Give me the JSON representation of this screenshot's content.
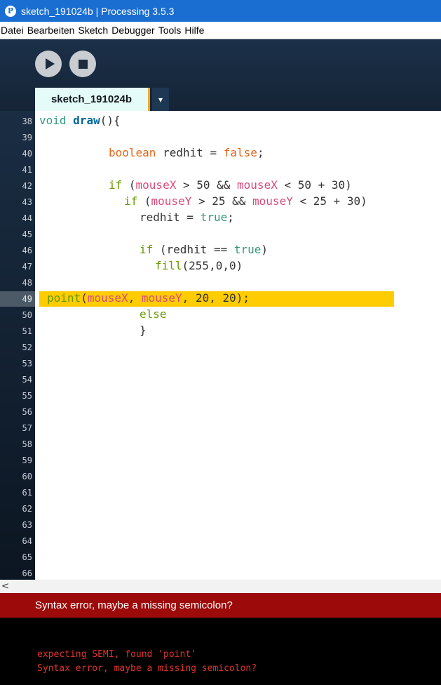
{
  "window": {
    "title": "sketch_191024b | Processing 3.5.3",
    "app_icon_glyph": "P"
  },
  "menu": [
    "Datei",
    "Bearbeiten",
    "Sketch",
    "Debugger",
    "Tools",
    "Hilfe"
  ],
  "toolbar": {
    "run_icon": "play-icon",
    "stop_icon": "stop-icon"
  },
  "tab": {
    "name": "sketch_191024b",
    "menu_glyph": "▾"
  },
  "line_numbers": [
    "38",
    "39",
    "40",
    "41",
    "42",
    "43",
    "44",
    "45",
    "46",
    "47",
    "48",
    "49",
    "50",
    "51",
    "52",
    "53",
    "54",
    "55",
    "56",
    "57",
    "58",
    "59",
    "60",
    "61",
    "62",
    "63",
    "64",
    "65",
    "66"
  ],
  "current_line": "49",
  "code": {
    "l38": {
      "kw": "void",
      "fn": "draw",
      "rest": "(){"
    },
    "l40": {
      "type": "boolean",
      "rest_a": " redhit = ",
      "type_b": "false",
      "rest_b": ";"
    },
    "l42": {
      "kw": "if",
      "a": " (",
      "v1": "mouseX",
      "b": " > 50 && ",
      "v2": "mouseX",
      "c": " < 50 + 30)"
    },
    "l43": {
      "kw": "if",
      "a": " (",
      "v1": "mouseY",
      "b": " > 25 && ",
      "v2": "mouseY",
      "c": " < 25 + 30)"
    },
    "l44": {
      "a": "redhit = ",
      "kw": "true",
      "b": ";"
    },
    "l46": {
      "kw": "if",
      "a": " (redhit == ",
      "kw2": "true",
      "b": ")"
    },
    "l47": {
      "fn": "fill",
      "a": "(255,0,0)"
    },
    "l49": {
      "fn": "point",
      "a": "(",
      "v1": "mouseX",
      "b": ", ",
      "v2": "mouseY",
      "c": ", 20, 20);"
    },
    "l50": {
      "kw": "else"
    },
    "l51": {
      "a": "}"
    }
  },
  "scroll": {
    "left_arrow": "<"
  },
  "status": {
    "message": "Syntax error, maybe a missing semicolon?"
  },
  "console": {
    "line1": "expecting SEMI, found 'point'",
    "line2": "Syntax error, maybe a missing semicolon?"
  },
  "colors": {
    "title_bar": "#1b6ed1",
    "status_error": "#9c0a0a",
    "line_highlight": "#ffcc00",
    "console_text": "#e1322e"
  }
}
